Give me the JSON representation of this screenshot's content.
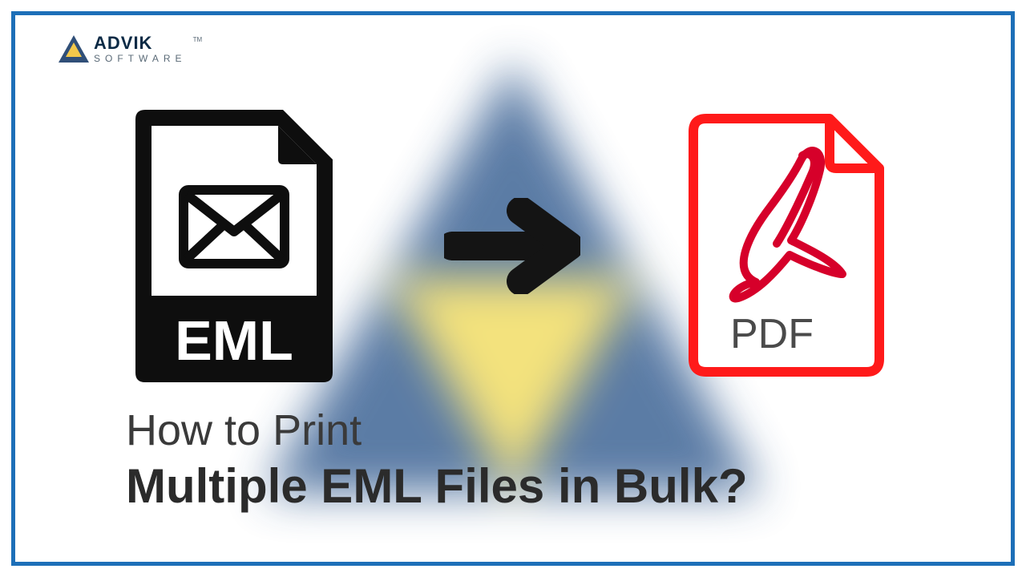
{
  "brand": {
    "name_top": "ADVIK",
    "name_bottom": "SOFTWARE",
    "tm": "TM"
  },
  "icons": {
    "eml_label": "EML",
    "pdf_label": "PDF",
    "arrow": "arrow-right",
    "adobe": "adobe-acrobat"
  },
  "headline": {
    "line1": "How to Print",
    "line2": "Multiple EML Files in Bulk?"
  },
  "colors": {
    "frame": "#1d6fb8",
    "pdf_red": "#ff1a1a",
    "text_dark": "#2b2b2b"
  }
}
